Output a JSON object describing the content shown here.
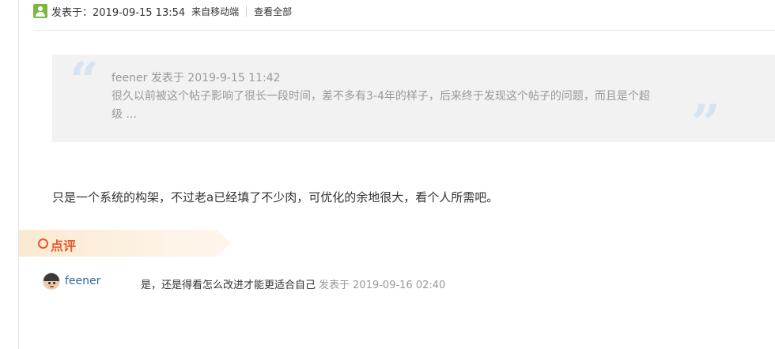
{
  "post": {
    "posted_time": "发表于：2019-09-15 13:54",
    "source": "来自移动端",
    "view_all": "查看全部"
  },
  "quote": {
    "author_line": "feener 发表于 2019-9-15 11:42",
    "text": "很久以前被这个帖子影响了很长一段时间，差不多有3-4年的样子，后来终于发现这个帖子的问题，而且是个超级 ..."
  },
  "reply": {
    "text": "只是一个系统的构架，不过老a已经填了不少肉，可优化的余地很大，看个人所需吧。"
  },
  "comments_section": {
    "title": "点评",
    "items": [
      {
        "author": "feener",
        "text": "是，还是得看怎么改进才能更适合自己",
        "time": "发表于 2019-09-16 02:40"
      }
    ]
  },
  "icons": {
    "online": "online-user-icon",
    "quote_open": "quote-open-icon",
    "quote_close": "quote-close-icon",
    "comment_bullet": "ring-bullet-icon",
    "avatar": "avatar"
  },
  "colors": {
    "accent": "#e8572d",
    "link": "#336699",
    "muted": "#999999",
    "online": "#7bb843",
    "quote_mark": "#d6e3f0"
  }
}
